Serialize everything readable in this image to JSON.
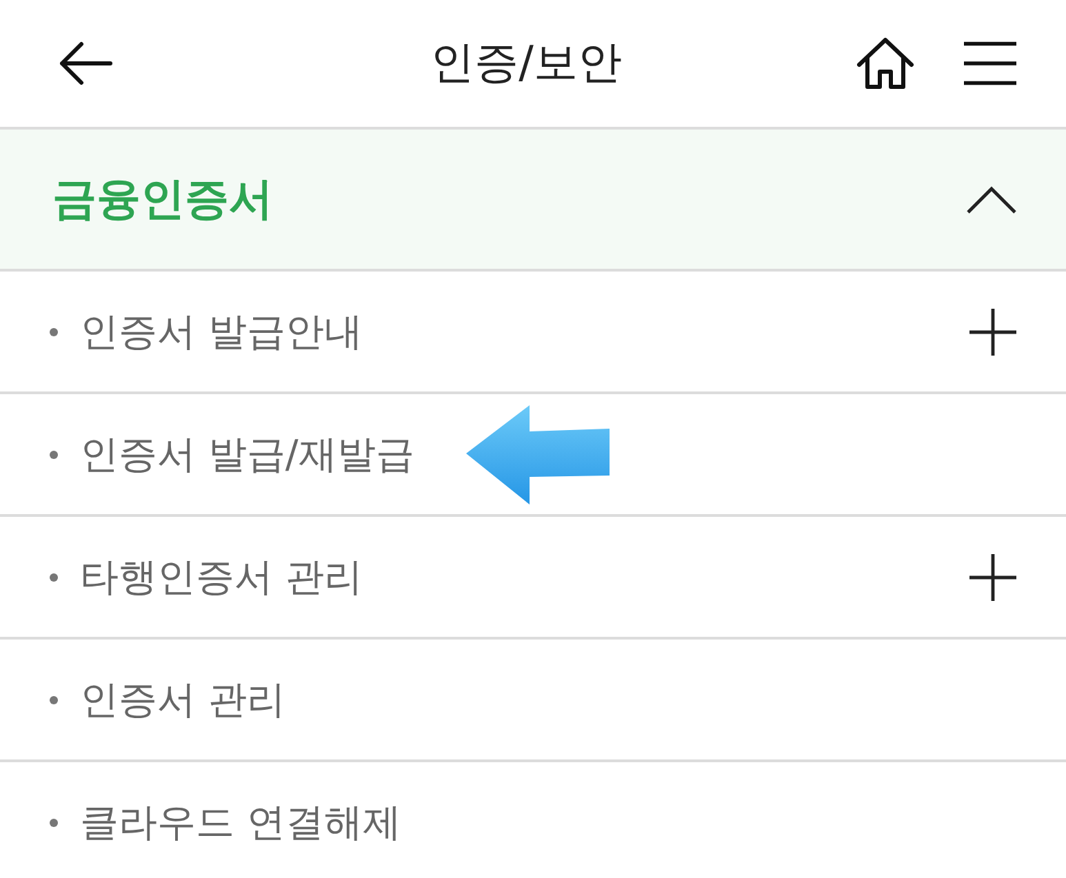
{
  "header": {
    "title": "인증/보안"
  },
  "section": {
    "title": "금융인증서",
    "expanded": true,
    "items": [
      {
        "label": "인증서 발급안내",
        "expandable": true,
        "pointed": false
      },
      {
        "label": "인증서 발급/재발급",
        "expandable": false,
        "pointed": true
      },
      {
        "label": "타행인증서 관리",
        "expandable": true,
        "pointed": false
      },
      {
        "label": "인증서 관리",
        "expandable": false,
        "pointed": false
      },
      {
        "label": "클라우드 연결해제",
        "expandable": false,
        "pointed": false
      }
    ]
  }
}
